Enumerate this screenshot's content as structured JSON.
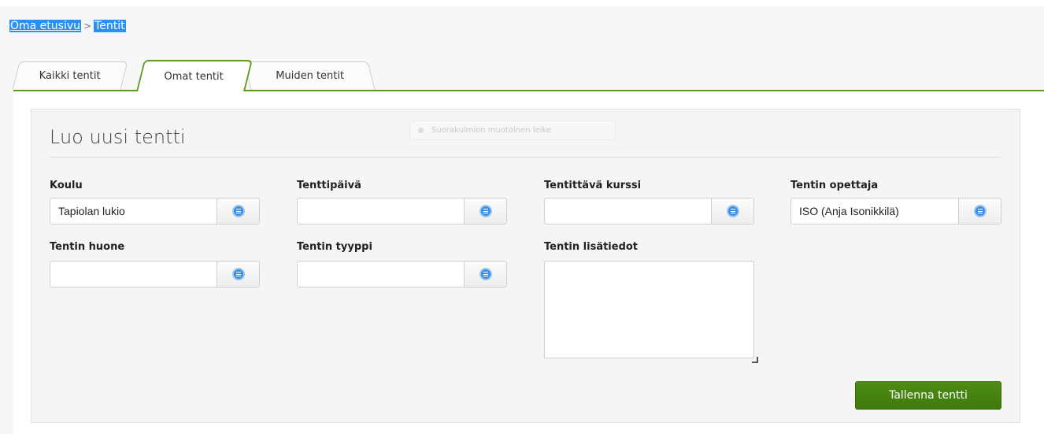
{
  "breadcrumb": {
    "home": "Oma etusivu",
    "separator": ">",
    "current": "Tentit"
  },
  "tabs": [
    {
      "label": "Kaikki tentit",
      "active": false
    },
    {
      "label": "Omat tentit",
      "active": true
    },
    {
      "label": "Muiden tentit",
      "active": false
    }
  ],
  "form": {
    "title": "Luo uusi tentti",
    "ghost_tooltip": "Suorakulmion muotoinen leike",
    "fields": {
      "school": {
        "label": "Koulu",
        "value": "Tapiolan lukio"
      },
      "date": {
        "label": "Tenttipäivä",
        "value": ""
      },
      "course": {
        "label": "Tentittävä kurssi",
        "value": ""
      },
      "teacher": {
        "label": "Tentin opettaja",
        "value": "ISO (Anja Isonikkilä)"
      },
      "room": {
        "label": "Tentin huone",
        "value": ""
      },
      "type": {
        "label": "Tentin tyyppi",
        "value": ""
      },
      "details": {
        "label": "Tentin lisätiedot",
        "value": ""
      }
    },
    "save_label": "Tallenna tentti"
  },
  "colors": {
    "accent_green": "#5a9b22",
    "button_green": "#467f10",
    "select_icon_blue": "#3c8fe0",
    "highlight_blue": "#2f8ff0"
  },
  "icons": {
    "picker": "list-icon"
  }
}
